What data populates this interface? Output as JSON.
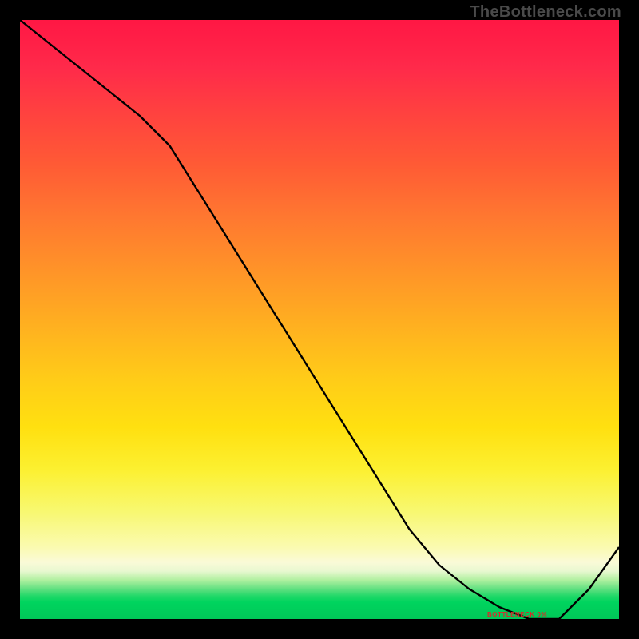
{
  "watermark": "TheBottleneck.com",
  "chart_data": {
    "type": "line",
    "title": "",
    "xlabel": "",
    "ylabel": "",
    "x": [
      0.0,
      0.05,
      0.1,
      0.15,
      0.2,
      0.25,
      0.3,
      0.35,
      0.4,
      0.45,
      0.5,
      0.55,
      0.6,
      0.65,
      0.7,
      0.75,
      0.8,
      0.85,
      0.9,
      0.95,
      1.0
    ],
    "y": [
      1.0,
      0.96,
      0.92,
      0.88,
      0.84,
      0.79,
      0.71,
      0.63,
      0.55,
      0.47,
      0.39,
      0.31,
      0.23,
      0.15,
      0.09,
      0.05,
      0.02,
      0.0,
      0.0,
      0.05,
      0.12
    ],
    "xlim": [
      0,
      1
    ],
    "ylim": [
      0,
      1
    ],
    "annotations": [
      {
        "text": "BOTTLENECK 0%",
        "x": 0.82,
        "y": 0.005
      }
    ],
    "background_gradient": {
      "type": "vertical",
      "stops": [
        {
          "pos": 0.0,
          "color": "#ff1744"
        },
        {
          "pos": 0.5,
          "color": "#ffcc18"
        },
        {
          "pos": 0.9,
          "color": "#fafad8"
        },
        {
          "pos": 1.0,
          "color": "#00c858"
        }
      ]
    }
  }
}
